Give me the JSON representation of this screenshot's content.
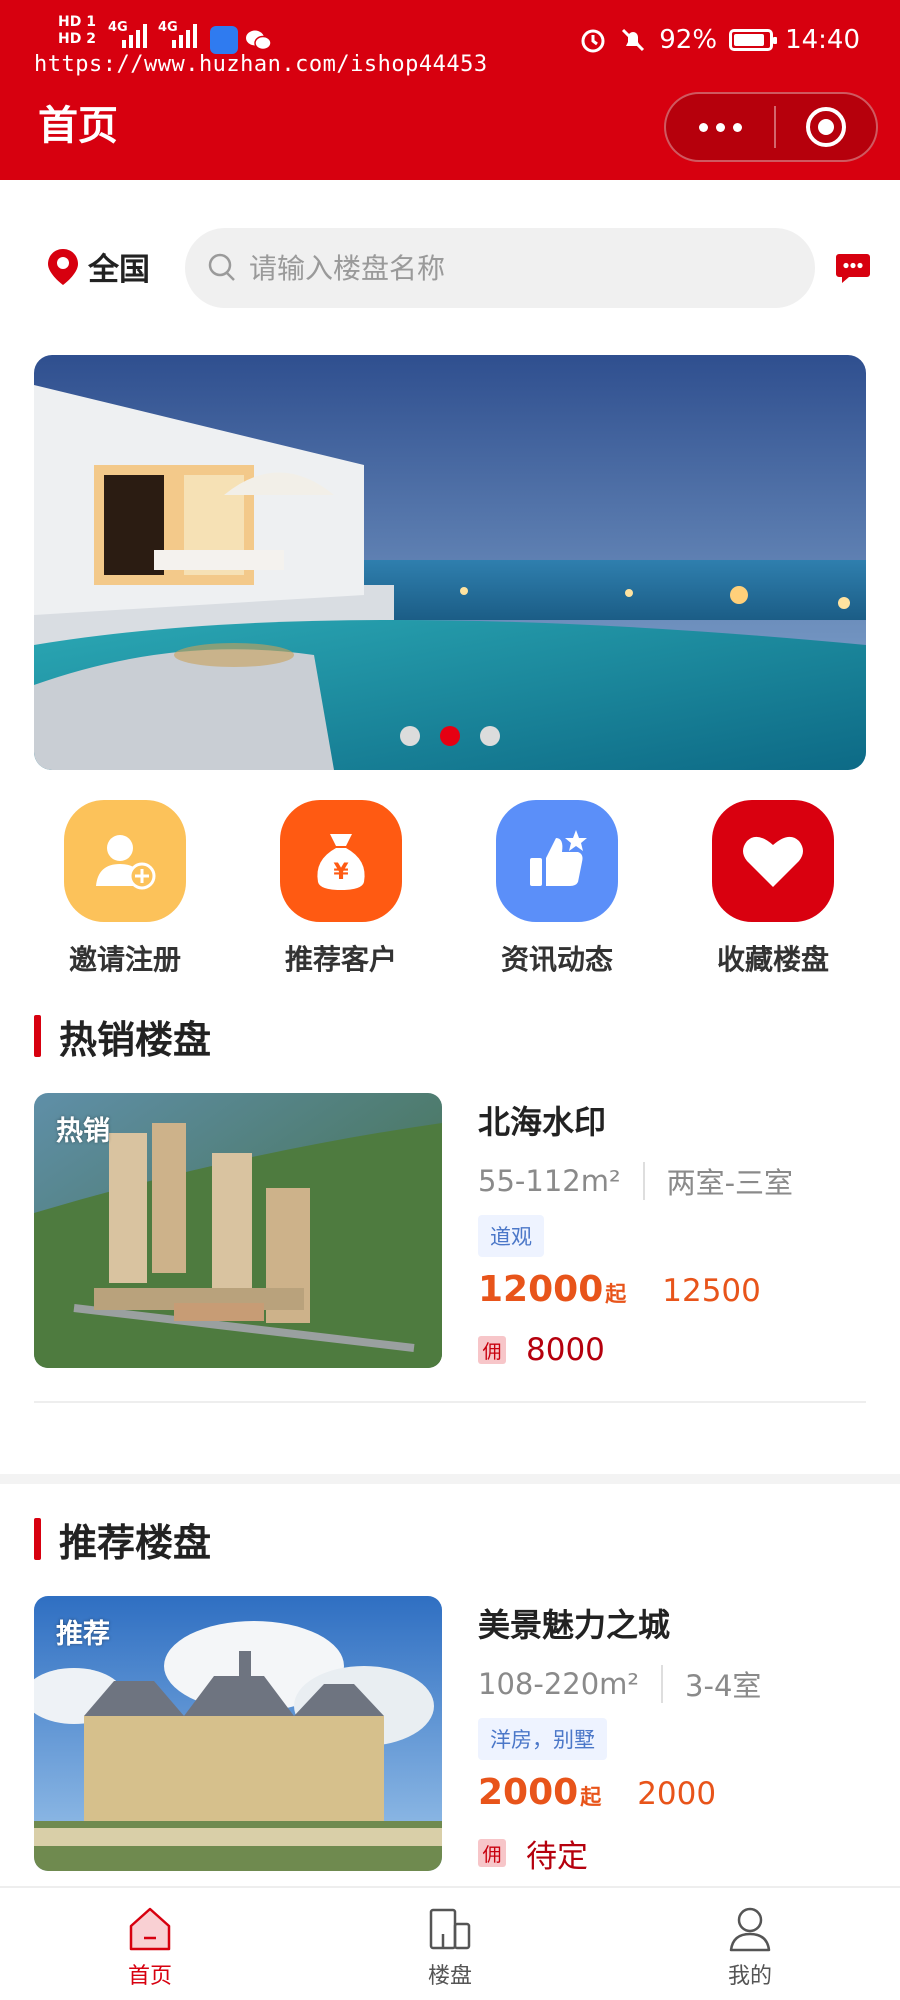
{
  "status_bar": {
    "hd1": "HD 1",
    "hd2": "HD 2",
    "net1": "4G",
    "net2": "4G",
    "battery": "92%",
    "time": "14:40",
    "watermark": "https://www.huzhan.com/ishop44453"
  },
  "header": {
    "title": "首页"
  },
  "search": {
    "location": "全国",
    "placeholder": "请输入楼盘名称"
  },
  "banner": {
    "dot_count": 3,
    "active_dot": 1
  },
  "quick_menu": [
    {
      "label": "邀请注册",
      "icon": "user-add-icon",
      "color": "#fcc25a"
    },
    {
      "label": "推荐客户",
      "icon": "money-bag-icon",
      "color": "#ff5a12"
    },
    {
      "label": "资讯动态",
      "icon": "thumbs-up-icon",
      "color": "#5b8ff9"
    },
    {
      "label": "收藏楼盘",
      "icon": "heart-icon",
      "color": "#d9000f"
    }
  ],
  "sections": [
    {
      "title": "热销楼盘",
      "card": {
        "tag": "热销",
        "name": "北海水印",
        "area": "55-112m²",
        "rooms": "两室-三室",
        "label": "道观",
        "price": "12000",
        "price_unit": "起",
        "price_alt": "12500",
        "commission_badge": "佣",
        "commission": "8000"
      }
    },
    {
      "title": "推荐楼盘",
      "card": {
        "tag": "推荐",
        "name": "美景魅力之城",
        "area": "108-220m²",
        "rooms": "3-4室",
        "label": "洋房，别墅",
        "price": "2000",
        "price_unit": "起",
        "price_alt": "2000",
        "commission_badge": "佣",
        "commission": "待定"
      }
    }
  ],
  "tabbar": [
    {
      "label": "首页",
      "icon": "home-icon",
      "active": true
    },
    {
      "label": "楼盘",
      "icon": "building-icon",
      "active": false
    },
    {
      "label": "我的",
      "icon": "user-icon",
      "active": false
    }
  ],
  "colors": {
    "brand_red": "#d7000f",
    "price_orange": "#e8541a",
    "tag_blue": "#4b77c8"
  }
}
